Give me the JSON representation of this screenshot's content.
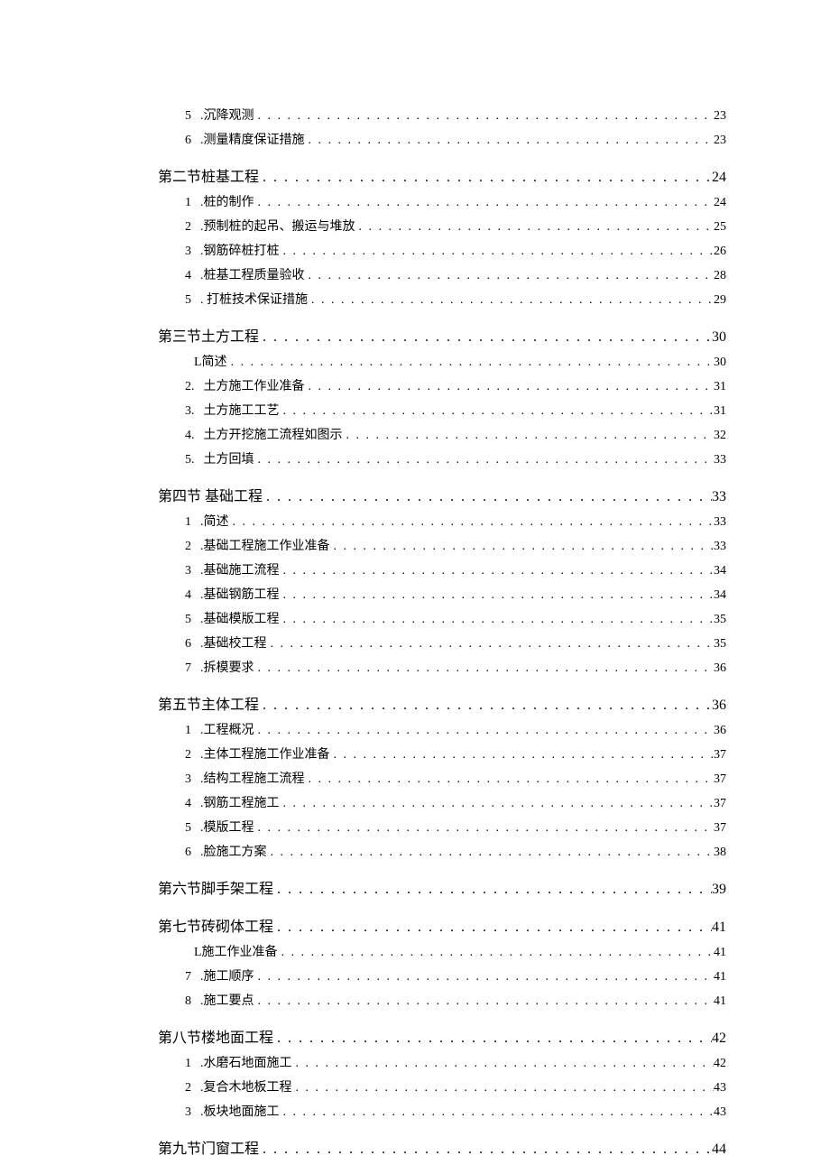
{
  "toc": [
    {
      "level": "sub",
      "num": "5",
      "label": ".沉降观测",
      "page": "23"
    },
    {
      "level": "sub",
      "num": "6",
      "label": ".测量精度保证措施",
      "page": "23"
    },
    {
      "level": "section",
      "num": "",
      "label": "第二节桩基工程",
      "page": "24"
    },
    {
      "level": "sub",
      "num": "1",
      "label": ".桩的制作",
      "page": "24"
    },
    {
      "level": "sub",
      "num": "2",
      "label": ".预制桩的起吊、搬运与堆放",
      "page": "25"
    },
    {
      "level": "sub",
      "num": "3",
      "label": ".钢筋碎桩打桩",
      "page": "26"
    },
    {
      "level": "sub",
      "num": "4",
      "label": ".桩基工程质量验收",
      "page": "28"
    },
    {
      "level": "sub",
      "num": "5",
      "label": ". 打桩技术保证措施",
      "page": "29"
    },
    {
      "level": "section",
      "num": "",
      "label": "第三节土方工程",
      "page": "30"
    },
    {
      "level": "sub",
      "num": "",
      "label": "L简述",
      "page": "30"
    },
    {
      "level": "sub",
      "num": "2.",
      "label": " 土方施工作业准备",
      "page": "31"
    },
    {
      "level": "sub",
      "num": "3.",
      "label": " 土方施工工艺",
      "page": "31"
    },
    {
      "level": "sub",
      "num": "4.",
      "label": " 土方开挖施工流程如图示",
      "page": "32"
    },
    {
      "level": "sub",
      "num": "5.",
      "label": " 土方回填",
      "page": "33"
    },
    {
      "level": "section",
      "num": "",
      "label": "第四节 基础工程",
      "page": "33"
    },
    {
      "level": "sub",
      "num": "1",
      "label": ".简述",
      "page": "33"
    },
    {
      "level": "sub",
      "num": "2",
      "label": ".基础工程施工作业准备",
      "page": "33"
    },
    {
      "level": "sub",
      "num": "3",
      "label": ".基础施工流程",
      "page": "34"
    },
    {
      "level": "sub",
      "num": "4",
      "label": ".基础钢筋工程",
      "page": "34"
    },
    {
      "level": "sub",
      "num": "5",
      "label": ".基础模版工程",
      "page": "35"
    },
    {
      "level": "sub",
      "num": "6",
      "label": ".基础校工程",
      "page": "35"
    },
    {
      "level": "sub",
      "num": "7",
      "label": ".拆模要求",
      "page": "36"
    },
    {
      "level": "section",
      "num": "",
      "label": "第五节主体工程",
      "page": "36"
    },
    {
      "level": "sub",
      "num": "1",
      "label": ".工程概况",
      "page": "36"
    },
    {
      "level": "sub",
      "num": "2",
      "label": ".主体工程施工作业准备",
      "page": "37"
    },
    {
      "level": "sub",
      "num": "3",
      "label": ".结构工程施工流程",
      "page": "37"
    },
    {
      "level": "sub",
      "num": "4",
      "label": ".钢筋工程施工",
      "page": "37"
    },
    {
      "level": "sub",
      "num": "5",
      "label": ".模版工程",
      "page": "37"
    },
    {
      "level": "sub",
      "num": "6",
      "label": ".脸施工方案",
      "page": "38"
    },
    {
      "level": "section",
      "num": "",
      "label": "第六节脚手架工程",
      "page": "39"
    },
    {
      "level": "section",
      "num": "",
      "label": "第七节砖砌体工程",
      "page": "41"
    },
    {
      "level": "sub",
      "num": "",
      "label": "L施工作业准备",
      "page": "41"
    },
    {
      "level": "sub",
      "num": "7",
      "label": ".施工顺序",
      "page": "41"
    },
    {
      "level": "sub",
      "num": "8",
      "label": ".施工要点",
      "page": "41"
    },
    {
      "level": "section",
      "num": "",
      "label": "第八节楼地面工程",
      "page": "42"
    },
    {
      "level": "sub",
      "num": "1",
      "label": ".水磨石地面施工",
      "page": "42"
    },
    {
      "level": "sub",
      "num": "2",
      "label": ".复合木地板工程",
      "page": "43"
    },
    {
      "level": "sub",
      "num": "3",
      "label": ".板块地面施工",
      "page": "43"
    },
    {
      "level": "section",
      "num": "",
      "label": "第九节门窗工程",
      "page": "44"
    }
  ]
}
